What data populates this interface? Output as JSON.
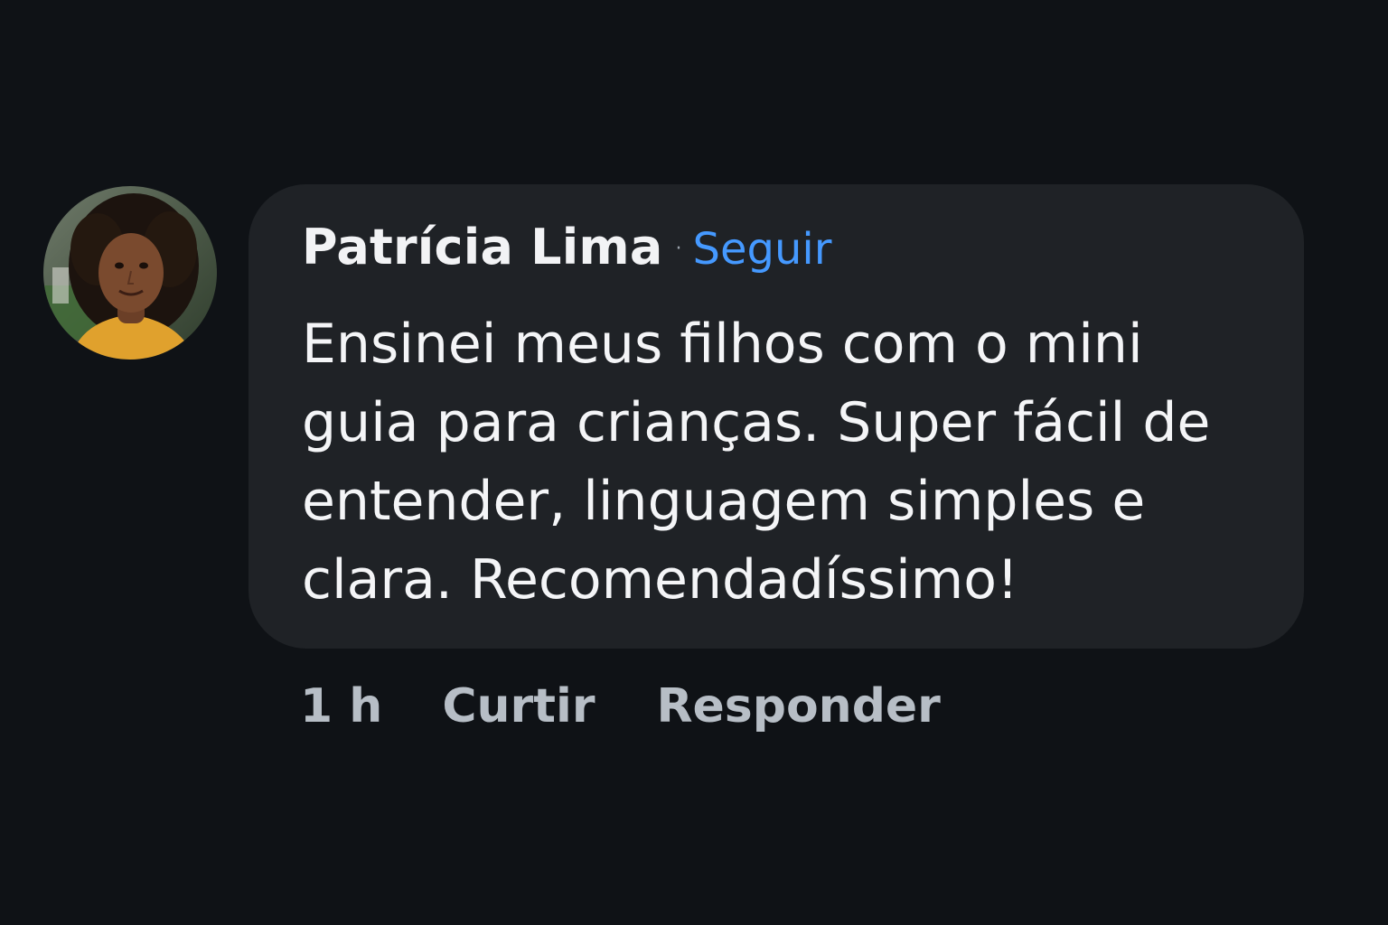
{
  "comment": {
    "author": {
      "name": "Patrícia Lima",
      "avatar_icon": "user-avatar-photo"
    },
    "separator": "·",
    "follow_label": "Seguir",
    "text": "Ensinei meus filhos com o mini guia para crianças. Super fácil de entender, linguagem simples e clara. Recomendadíssimo!",
    "time": "1 h",
    "actions": {
      "like_label": "Curtir",
      "reply_label": "Responder"
    }
  },
  "colors": {
    "background": "#0f1216",
    "bubble": "#1f2226",
    "link": "#4599ff",
    "action_text": "#b7bec6"
  }
}
